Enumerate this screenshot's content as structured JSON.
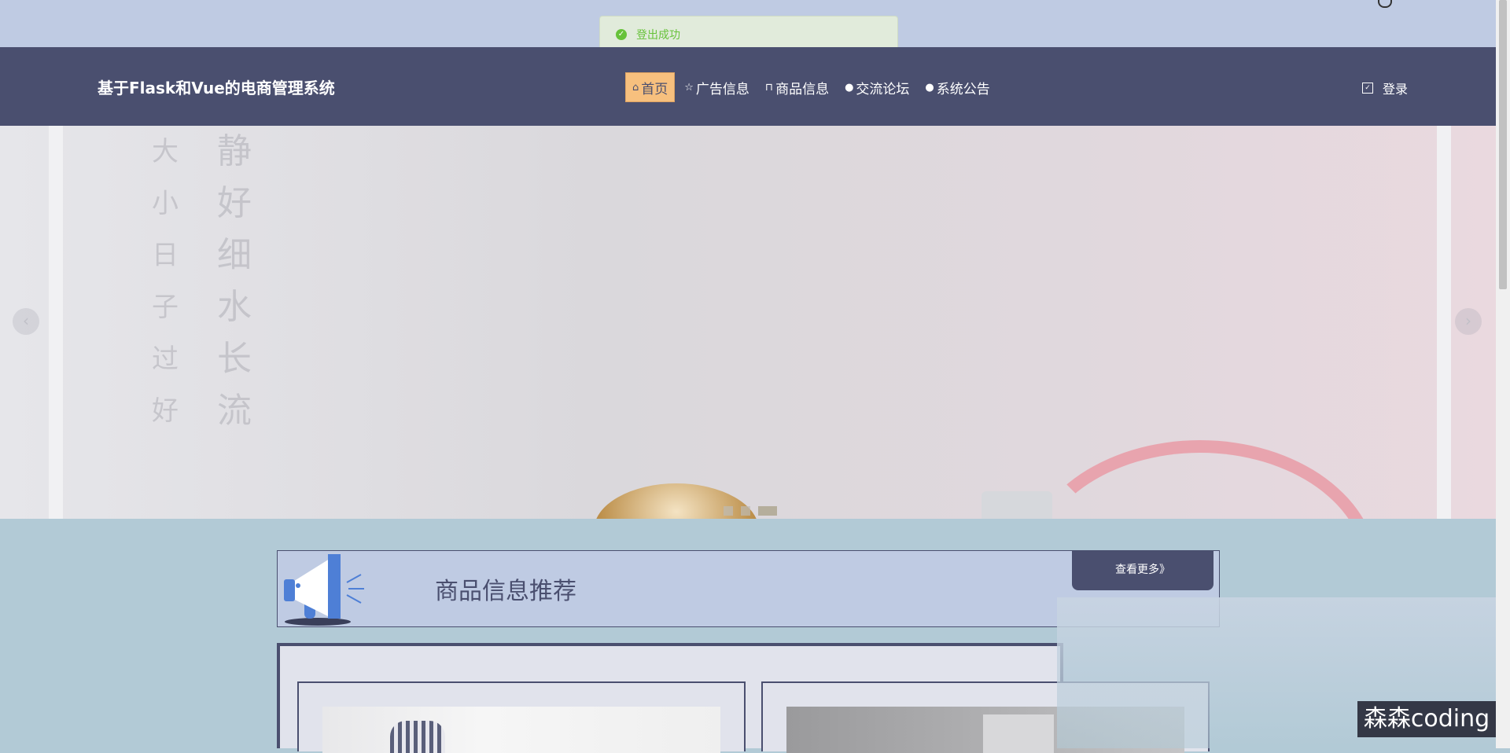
{
  "toast": {
    "message": "登出成功"
  },
  "header": {
    "brand": "基于Flask和Vue的电商管理系统",
    "menu": [
      {
        "label": "首页",
        "icon": "home-icon"
      },
      {
        "label": "广告信息",
        "icon": "star-icon"
      },
      {
        "label": "商品信息",
        "icon": "bag-icon"
      },
      {
        "label": "交流论坛",
        "icon": "info-icon"
      },
      {
        "label": "系统公告",
        "icon": "question-icon"
      }
    ],
    "login": "登录"
  },
  "banner": {
    "left_chars": [
      "静",
      "好",
      "细",
      "水",
      "长",
      "流"
    ],
    "left_chars2": [
      "大",
      "小",
      "日",
      "子",
      "过",
      "好"
    ]
  },
  "recommend": {
    "title": "商品信息推荐",
    "more": "查看更多》"
  },
  "watermark": "森森coding",
  "colors": {
    "nav": "#4a4f6f",
    "accent": "#f7c07e",
    "band": "#bfcbe3",
    "page": "#b2cad6"
  }
}
